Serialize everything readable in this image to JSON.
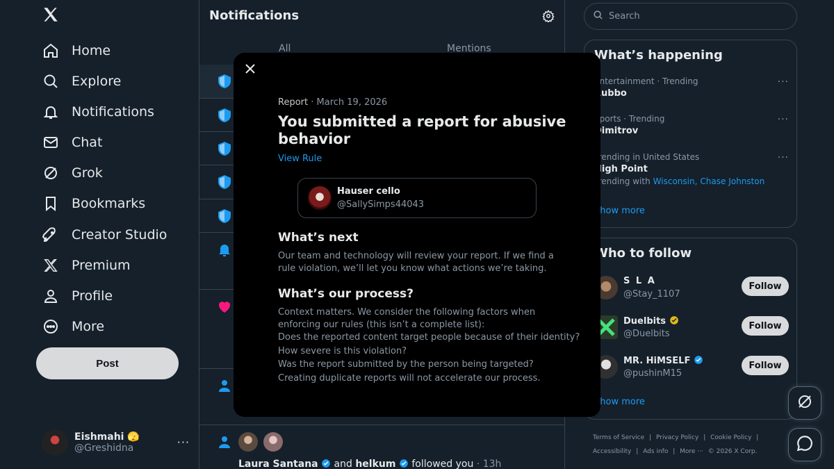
{
  "nav": {
    "items": [
      {
        "icon": "home-icon",
        "label": "Home"
      },
      {
        "icon": "search-icon",
        "label": "Explore"
      },
      {
        "icon": "bell-icon",
        "label": "Notifications"
      },
      {
        "icon": "mail-icon",
        "label": "Chat"
      },
      {
        "icon": "grok-icon",
        "label": "Grok"
      },
      {
        "icon": "bookmark-icon",
        "label": "Bookmarks"
      },
      {
        "icon": "rocket-icon",
        "label": "Creator Studio"
      },
      {
        "icon": "x-logo-icon",
        "label": "Premium"
      },
      {
        "icon": "person-icon",
        "label": "Profile"
      },
      {
        "icon": "more-circle-icon",
        "label": "More"
      }
    ],
    "post_label": "Post",
    "account": {
      "name": "Eishmahi 🫣",
      "handle": "@Greshidna",
      "more": "···"
    }
  },
  "middle": {
    "title": "Notifications",
    "tabs": [
      "All",
      "Mentions"
    ],
    "bottom_row": {
      "user1": "Laura Santana",
      "conj": "and",
      "user2": "helkum",
      "action": "followed you",
      "time": "· 13h"
    }
  },
  "search": {
    "placeholder": "Search"
  },
  "happening": {
    "title": "What’s happening",
    "trends": [
      {
        "meta": "Entertainment · Trending",
        "name": "Rubbo"
      },
      {
        "meta": "Sports · Trending",
        "name": "Dimitrov"
      },
      {
        "meta": "Trending in United States",
        "name": "High Point",
        "with_label": "Trending with",
        "with": [
          "Wisconsin,",
          "Chase Johnston"
        ]
      }
    ],
    "show_more": "Show more"
  },
  "who_to_follow": {
    "title": "Who to follow",
    "users": [
      {
        "name": "S L A",
        "handle": "@Stay_1107",
        "verified": false,
        "button": "Follow"
      },
      {
        "name": "Duelbits",
        "handle": "@Duelbits",
        "verified": true,
        "badge_color": "#e2b719",
        "button": "Follow"
      },
      {
        "name": "MR. HiMSELF",
        "handle": "@pushinM15",
        "verified": true,
        "badge_color": "#1d9bf0",
        "button": "Follow"
      }
    ],
    "show_more": "Show more"
  },
  "footer": {
    "links": [
      "Terms of Service",
      "|",
      "Privacy Policy",
      "|",
      "Cookie Policy",
      "|",
      "Accessibility",
      "|",
      "Ads info",
      "|",
      "More ···",
      "© 2026 X Corp."
    ]
  },
  "modal": {
    "meta_label": "Report",
    "meta_date": "· March 19, 2026",
    "title": "You submitted a report for abusive behavior",
    "view_rule": "View Rule",
    "reported_user": {
      "name": "Hauser cello",
      "handle": "@SallySimps44043"
    },
    "next_heading": "What’s next",
    "next_body": "Our team and technology will review your report. If we find a rule violation, we’ll let you know what actions we’re taking.",
    "process_heading": "What’s our process?",
    "process_intro": "Context matters. We consider the following factors when enforcing our rules (this isn’t a complete list):",
    "process_items": [
      "Does the reported content target people because of their identity?",
      "How severe is this violation?",
      "Was the report submitted by the person being targeted?",
      "Creating duplicate reports will not accelerate our process."
    ]
  },
  "colors": {
    "background": "#15202b",
    "accent": "#1d9bf0",
    "modal_bg": "#000000",
    "heart": "#f91880"
  }
}
